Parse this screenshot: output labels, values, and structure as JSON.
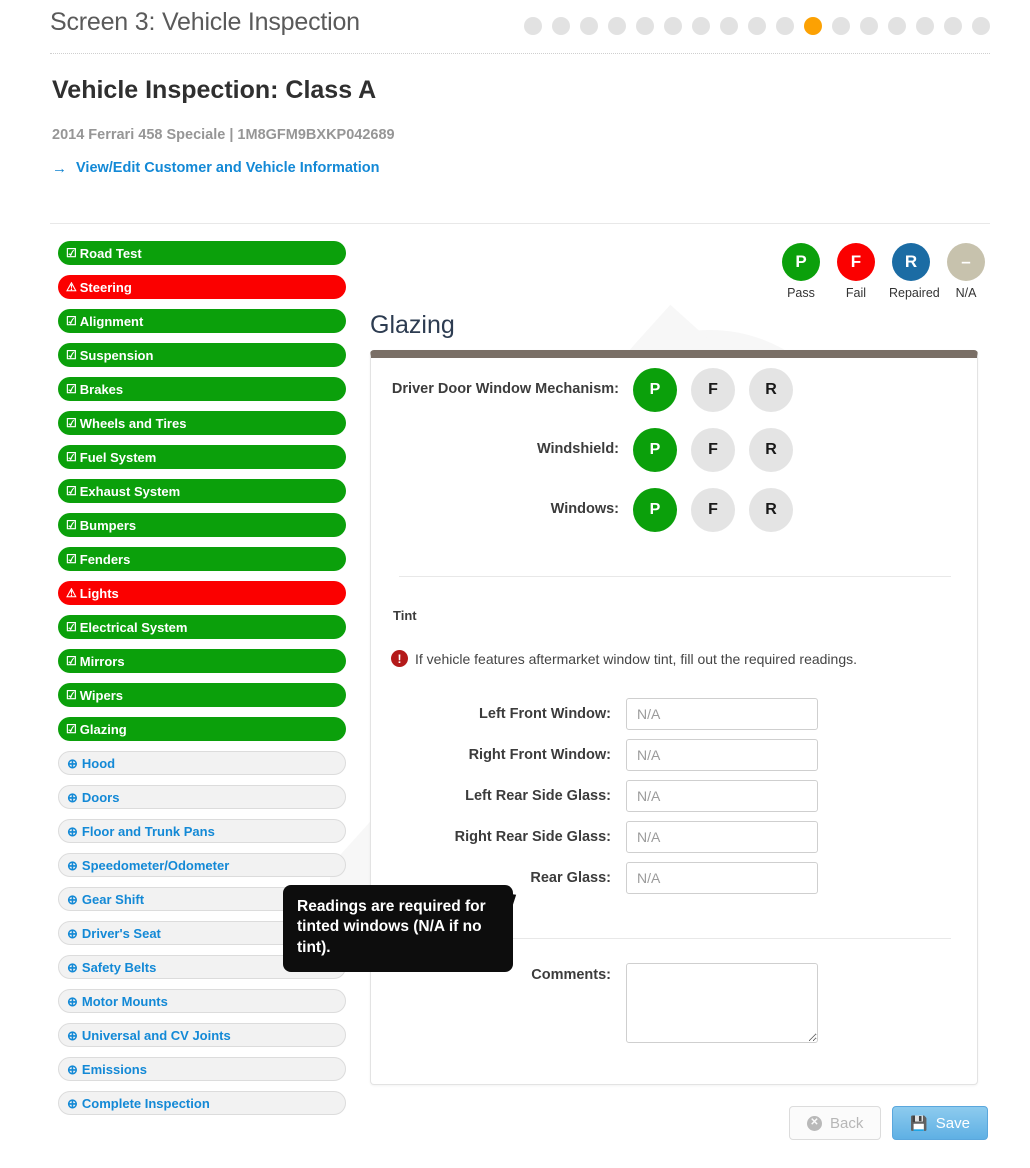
{
  "header": {
    "screen_title": "Screen 3: Vehicle Inspection",
    "progress": {
      "total": 17,
      "active_index": 11
    }
  },
  "titles": {
    "page_title": "Vehicle Inspection: Class A",
    "vehicle_line": "2014 Ferrari 458 Speciale | 1M8GFM9BXKP042689",
    "edit_link": "View/Edit Customer and Vehicle Information",
    "arrow_icon": "→"
  },
  "sidebar": {
    "check_icon": "☑",
    "warn_icon": "⚠",
    "todo_icon": "⊕",
    "items": [
      {
        "label": "Road Test",
        "state": "done"
      },
      {
        "label": "Steering",
        "state": "fail"
      },
      {
        "label": "Alignment",
        "state": "done"
      },
      {
        "label": "Suspension",
        "state": "done"
      },
      {
        "label": "Brakes",
        "state": "done"
      },
      {
        "label": "Wheels and Tires",
        "state": "done"
      },
      {
        "label": "Fuel System",
        "state": "done"
      },
      {
        "label": "Exhaust System",
        "state": "done"
      },
      {
        "label": "Bumpers",
        "state": "done"
      },
      {
        "label": "Fenders",
        "state": "done"
      },
      {
        "label": "Lights",
        "state": "fail"
      },
      {
        "label": "Electrical System",
        "state": "done"
      },
      {
        "label": "Mirrors",
        "state": "done"
      },
      {
        "label": "Wipers",
        "state": "done"
      },
      {
        "label": "Glazing",
        "state": "done"
      },
      {
        "label": "Hood",
        "state": "todo"
      },
      {
        "label": "Doors",
        "state": "todo"
      },
      {
        "label": "Floor and Trunk Pans",
        "state": "todo"
      },
      {
        "label": "Speedometer/Odometer",
        "state": "todo"
      },
      {
        "label": "Gear Shift",
        "state": "todo"
      },
      {
        "label": "Driver's Seat",
        "state": "todo"
      },
      {
        "label": "Safety Belts",
        "state": "todo"
      },
      {
        "label": "Motor Mounts",
        "state": "todo"
      },
      {
        "label": "Universal and CV Joints",
        "state": "todo"
      },
      {
        "label": "Emissions",
        "state": "todo"
      },
      {
        "label": "Complete Inspection",
        "state": "todo"
      }
    ]
  },
  "legend": {
    "items": [
      {
        "glyph": "P",
        "label": "Pass",
        "color": "#0ba00b",
        "cls": "lg-pass"
      },
      {
        "glyph": "F",
        "label": "Fail",
        "color": "#fb0000",
        "cls": "lg-fail"
      },
      {
        "glyph": "R",
        "label": "Repaired",
        "color": "#1b6ca4",
        "cls": "lg-rep"
      },
      {
        "glyph": "–",
        "label": "N/A",
        "color": "#c7c2ad",
        "cls": "lg-na"
      }
    ]
  },
  "section": {
    "heading": "Glazing",
    "pfr_rows": [
      {
        "label": "Driver Door Window Mechanism:",
        "selected": "P",
        "options": [
          "P",
          "F",
          "R"
        ]
      },
      {
        "label": "Windshield:",
        "selected": "P",
        "options": [
          "P",
          "F",
          "R"
        ]
      },
      {
        "label": "Windows:",
        "selected": "P",
        "options": [
          "P",
          "F",
          "R"
        ]
      }
    ],
    "tint": {
      "title": "Tint",
      "note_icon": "!",
      "note": "If vehicle features aftermarket window tint, fill out the required readings.",
      "fields": [
        {
          "label": "Left Front Window:",
          "value": "",
          "placeholder": "N/A"
        },
        {
          "label": "Right Front Window:",
          "value": "",
          "placeholder": "N/A"
        },
        {
          "label": "Left Rear Side Glass:",
          "value": "",
          "placeholder": "N/A"
        },
        {
          "label": "Right Rear Side Glass:",
          "value": "",
          "placeholder": "N/A"
        },
        {
          "label": "Rear Glass:",
          "value": "",
          "placeholder": "N/A"
        }
      ]
    },
    "comments": {
      "label": "Comments:",
      "value": "",
      "placeholder": ""
    }
  },
  "tooltip": {
    "text": "Readings are required for tinted windows (N/A  if no tint)."
  },
  "footer": {
    "back_label": "Back",
    "back_icon": "✕",
    "save_label": "Save",
    "save_icon": "💾"
  }
}
